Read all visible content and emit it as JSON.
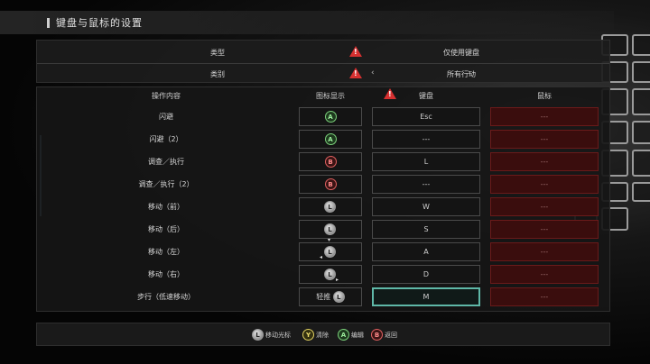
{
  "title": "键盘与鼠标的设置",
  "top": {
    "type_label": "类型",
    "type_value": "仅使用键盘",
    "category_label": "类别",
    "category_value": "所有行动",
    "prev_arrow": "‹",
    "next_arrow": "›"
  },
  "headers": {
    "action": "操作内容",
    "icon": "图标显示",
    "keyboard": "键盘",
    "mouse": "鼠标"
  },
  "rows": [
    {
      "name": "闪避",
      "icon": "A",
      "key": "Esc",
      "mouse": "---"
    },
    {
      "name": "闪避（2）",
      "icon": "A",
      "key": "---",
      "mouse": "---"
    },
    {
      "name": "调查／执行",
      "icon": "B",
      "key": "L",
      "mouse": "---"
    },
    {
      "name": "调查／执行（2）",
      "icon": "B",
      "key": "---",
      "mouse": "---"
    },
    {
      "name": "移动（前）",
      "icon": "L",
      "key": "W",
      "mouse": "---"
    },
    {
      "name": "移动（后）",
      "icon": "L",
      "key": "S",
      "mouse": "---"
    },
    {
      "name": "移动（左）",
      "icon": "L",
      "key": "A",
      "mouse": "---"
    },
    {
      "name": "移动（右）",
      "icon": "L",
      "key": "D",
      "mouse": "---"
    },
    {
      "name": "步行（低速移动）",
      "icon_text": "轻推",
      "icon": "L",
      "key": "M",
      "mouse": "---"
    }
  ],
  "footer": {
    "move_cursor": "移动光标",
    "clear": "清除",
    "edit": "编辑",
    "back": "返回",
    "y_glyph": "Y",
    "a_glyph": "A",
    "b_glyph": "B",
    "stick_glyph": "L"
  },
  "colors": {
    "accent_select": "#5fb8a8",
    "warning": "#d63030",
    "mouse_cell": "#3a0d0d"
  }
}
